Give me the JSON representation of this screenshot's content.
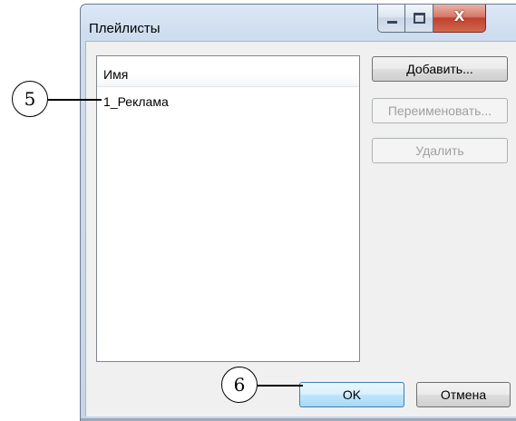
{
  "window": {
    "title": "Плейлисты",
    "minimize_icon": "minimize-icon",
    "maximize_icon": "maximize-icon",
    "close_icon": "close-icon",
    "close_glyph": "X"
  },
  "list": {
    "column_header": "Имя",
    "items": [
      "1_Реклама"
    ]
  },
  "buttons": {
    "add": "Добавить...",
    "rename": "Переименовать...",
    "delete": "Удалить",
    "ok": "OK",
    "cancel": "Отмена"
  },
  "callouts": [
    "5",
    "6"
  ],
  "colors": {
    "close_button": "#c0402b",
    "ok_button_border": "#3c7fb1",
    "disabled_text": "#a0a0a0"
  }
}
